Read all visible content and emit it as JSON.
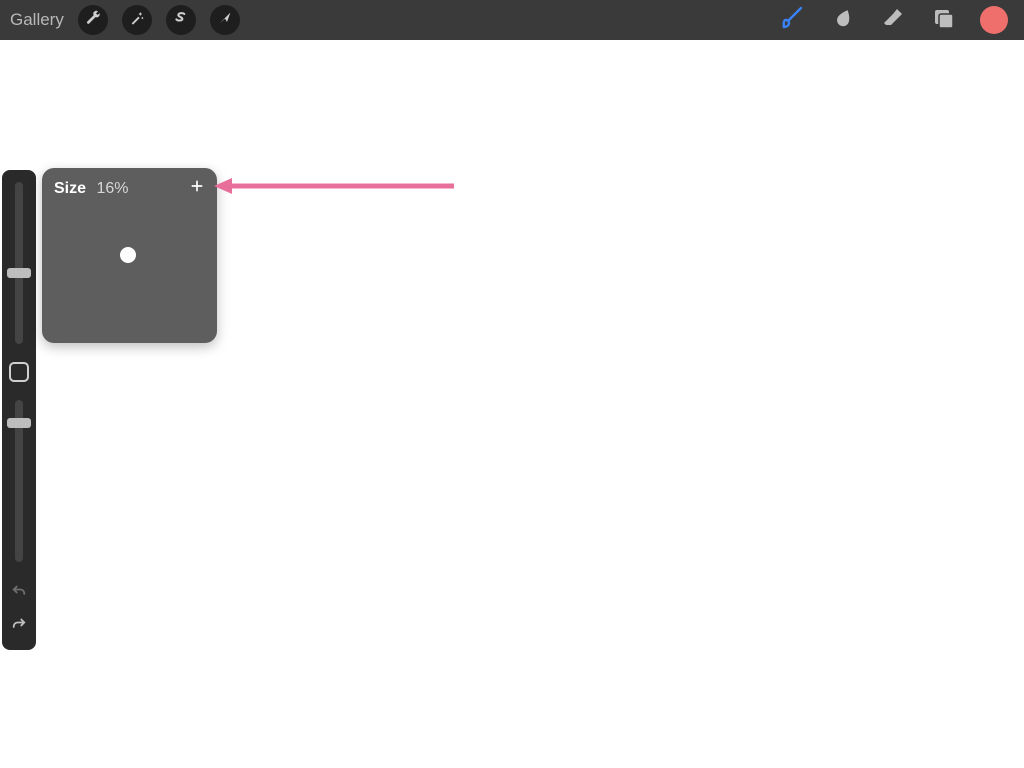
{
  "topbar": {
    "gallery_label": "Gallery"
  },
  "popover": {
    "label": "Size",
    "value": "16%"
  },
  "colors": {
    "brush_active": "#3a82f7",
    "color_chip": "#ef6f6c",
    "arrow": "#e76f9a"
  }
}
